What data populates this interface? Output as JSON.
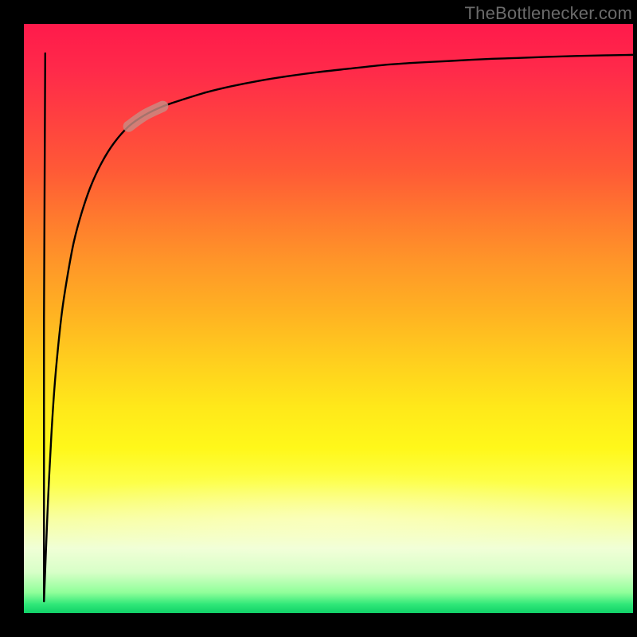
{
  "watermark": "TheBottlenecker.com",
  "colors": {
    "page_bg": "#000000",
    "curve_stroke": "#000000",
    "highlight_stroke": "#c98b82",
    "gradient_top": "#ff1a4b",
    "gradient_bottom": "#10d068"
  },
  "chart_data": {
    "type": "line",
    "title": "",
    "xlabel": "",
    "ylabel": "",
    "xlim": [
      0,
      100
    ],
    "ylim": [
      0,
      100
    ],
    "grid": false,
    "series": [
      {
        "name": "curve",
        "x": [
          3.3,
          3.6,
          4.0,
          4.5,
          5.0,
          5.6,
          6.3,
          7.2,
          8.2,
          9.5,
          11.0,
          12.8,
          14.8,
          17.2,
          19.8,
          22.8,
          26.2,
          30.0,
          34.0,
          38.4,
          43.2,
          48.2,
          53.4,
          58.8,
          64.2,
          69.8,
          75.2,
          80.6,
          85.8,
          90.6,
          95.0,
          98.8,
          100.0
        ],
        "values": [
          2.0,
          10.0,
          20.0,
          30.0,
          38.0,
          45.0,
          51.5,
          57.5,
          63.0,
          68.0,
          72.5,
          76.5,
          79.8,
          82.6,
          84.5,
          86.0,
          87.2,
          88.4,
          89.4,
          90.3,
          91.1,
          91.8,
          92.4,
          93.0,
          93.4,
          93.7,
          94.0,
          94.2,
          94.4,
          94.55,
          94.65,
          94.72,
          94.75
        ]
      }
    ],
    "highlight_segment": {
      "series": "curve",
      "x_start": 17.2,
      "x_end": 22.8,
      "note": "short thick pale segment on the knee of the curve"
    }
  }
}
